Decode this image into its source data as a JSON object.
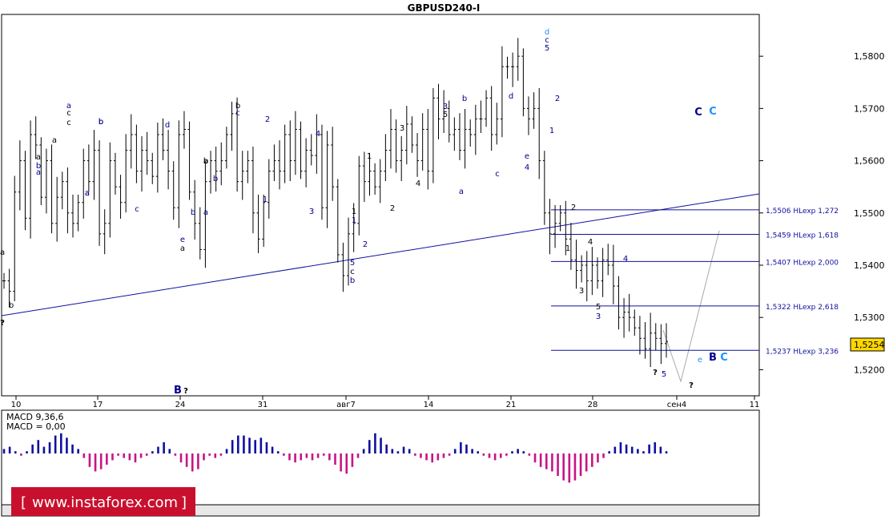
{
  "chart_title": "GBPUSD240-I",
  "chart_data": {
    "type": "line",
    "title": "GBPUSD240-I",
    "ylim": [
      1.515,
      1.588
    ],
    "y_ticks": [
      "1,5800",
      "1,5700",
      "1,5600",
      "1,5500",
      "1,5400",
      "1,5300",
      "1,5200"
    ],
    "y_tick_values": [
      1.58,
      1.57,
      1.56,
      1.55,
      1.54,
      1.53,
      1.52
    ],
    "x_ticks": [
      "10",
      "17",
      "24",
      "31",
      "авг7",
      "14",
      "21",
      "28",
      "сен4",
      "11"
    ],
    "current_price": "1,5254",
    "series": [
      {
        "values": [
          1.537,
          1.535,
          1.554,
          1.56,
          1.549,
          1.565,
          1.563,
          1.553,
          1.56,
          1.548,
          1.553,
          1.556,
          1.55,
          1.548,
          1.552,
          1.56,
          1.556,
          1.562,
          1.546,
          1.548,
          1.56,
          1.555,
          1.552,
          1.562,
          1.565,
          1.558,
          1.562,
          1.56,
          1.557,
          1.565,
          1.562,
          1.558,
          1.551,
          1.565,
          1.566,
          1.554,
          1.548,
          1.543,
          1.556,
          1.56,
          1.558,
          1.56,
          1.565,
          1.569,
          1.556,
          1.558,
          1.56,
          1.55,
          1.545,
          1.552,
          1.558,
          1.56,
          1.558,
          1.565,
          1.56,
          1.566,
          1.558,
          1.562,
          1.561,
          1.565,
          1.551,
          1.563,
          1.555,
          1.542,
          1.538,
          1.546,
          1.548,
          1.559,
          1.556,
          1.558,
          1.555,
          1.558,
          1.562,
          1.566,
          1.56,
          1.562,
          1.567,
          1.563,
          1.56,
          1.566,
          1.558,
          1.572,
          1.568,
          1.57,
          1.565,
          1.566,
          1.562,
          1.566,
          1.565,
          1.568,
          1.568,
          1.572,
          1.565,
          1.568,
          1.578,
          1.578,
          1.578,
          1.58,
          1.57,
          1.568,
          1.57,
          1.56,
          1.55,
          1.546,
          1.548,
          1.55,
          1.545,
          1.541,
          1.539,
          1.54,
          1.537,
          1.54,
          1.537,
          1.541,
          1.54,
          1.536,
          1.53,
          1.531,
          1.53,
          1.528,
          1.526,
          1.524,
          1.527,
          1.526,
          1.525,
          1.5254
        ]
      }
    ]
  },
  "fib_levels": [
    {
      "value": 1.5506,
      "label": "1,5506 HLexp 1,272"
    },
    {
      "value": 1.5459,
      "label": "1,5459 HLexp 1,618"
    },
    {
      "value": 1.5407,
      "label": "1,5407 HLexp 2,000"
    },
    {
      "value": 1.5322,
      "label": "1,5322 HLexp 2,618"
    },
    {
      "value": 1.5237,
      "label": "1,5237 HLexp 3,236"
    }
  ],
  "wave_labels": [
    {
      "t": "a",
      "c": "#000"
    },
    {
      "t": "b",
      "c": "#000"
    },
    {
      "t": "?",
      "c": "#000"
    },
    {
      "t": "a",
      "c": "#00008b"
    },
    {
      "t": "c",
      "c": "#000"
    },
    {
      "t": "a",
      "c": "#000"
    },
    {
      "t": "a",
      "c": "#000"
    },
    {
      "t": "b",
      "c": "#00008b"
    },
    {
      "t": "a",
      "c": "#00008b"
    },
    {
      "t": "a",
      "c": "#00008b"
    },
    {
      "t": "c",
      "c": "#000"
    },
    {
      "t": "b",
      "c": "#00008b"
    },
    {
      "t": "a",
      "c": "#00008b"
    },
    {
      "t": "b",
      "c": "#00008b"
    },
    {
      "t": "c",
      "c": "#00008b"
    },
    {
      "t": "d",
      "c": "#00008b"
    },
    {
      "t": "e",
      "c": "#00008b"
    },
    {
      "t": "a",
      "c": "#000"
    },
    {
      "t": "b",
      "c": "#00008b"
    },
    {
      "t": "b",
      "c": "#000"
    },
    {
      "t": "a",
      "c": "#00008b"
    },
    {
      "t": "b",
      "c": "#000"
    },
    {
      "t": "c",
      "c": "#00008b"
    },
    {
      "t": "a",
      "c": "#000"
    },
    {
      "t": "b",
      "c": "#00008b"
    },
    {
      "t": "2",
      "c": "#00008b"
    },
    {
      "t": "1",
      "c": "#00008b"
    },
    {
      "t": "4",
      "c": "#00008b"
    },
    {
      "t": "3",
      "c": "#00008b"
    },
    {
      "t": "1",
      "c": "#000"
    },
    {
      "t": "1",
      "c": "#000"
    },
    {
      "t": "5",
      "c": "#00008b"
    },
    {
      "t": "c",
      "c": "#000"
    },
    {
      "t": "b",
      "c": "#00008b"
    },
    {
      "t": "2",
      "c": "#00008b"
    },
    {
      "t": "1",
      "c": "#00008b"
    },
    {
      "t": "2",
      "c": "#000"
    },
    {
      "t": "3",
      "c": "#000"
    },
    {
      "t": "4",
      "c": "#000"
    },
    {
      "t": "3",
      "c": "#00008b"
    },
    {
      "t": "5",
      "c": "#000"
    },
    {
      "t": "b",
      "c": "#00008b"
    },
    {
      "t": "a",
      "c": "#00008b"
    },
    {
      "t": "c",
      "c": "#00008b"
    },
    {
      "t": "d",
      "c": "#00008b"
    },
    {
      "t": "e",
      "c": "#00008b"
    },
    {
      "t": "4",
      "c": "#00008b"
    },
    {
      "t": "d",
      "c": "#1e90ff"
    },
    {
      "t": "c",
      "c": "#00008b"
    },
    {
      "t": "5",
      "c": "#00008b"
    },
    {
      "t": "2",
      "c": "#00008b"
    },
    {
      "t": "1",
      "c": "#00008b"
    },
    {
      "t": "2",
      "c": "#000"
    },
    {
      "t": "1",
      "c": "#000"
    },
    {
      "t": "4",
      "c": "#000"
    },
    {
      "t": "3",
      "c": "#000"
    },
    {
      "t": "5",
      "c": "#000"
    },
    {
      "t": "3",
      "c": "#00008b"
    },
    {
      "t": "4",
      "c": "#00008b"
    },
    {
      "t": "?",
      "c": "#000"
    },
    {
      "t": "5",
      "c": "#00008b"
    },
    {
      "t": "?",
      "c": "#000"
    },
    {
      "t": "C",
      "c": "#00008b"
    },
    {
      "t": "C",
      "c": "#1e90ff"
    },
    {
      "t": "e",
      "c": "#1e90ff"
    },
    {
      "t": "B",
      "c": "#00008b"
    },
    {
      "t": "C",
      "c": "#1e90ff"
    },
    {
      "t": "B",
      "c": "#00008b"
    },
    {
      "t": "?",
      "c": "#000"
    }
  ],
  "macd": {
    "label": "MACD 9,36,6",
    "value_label": "MACD = 0,00",
    "values": [
      0.2,
      0.3,
      0.1,
      -0.1,
      0.1,
      0.4,
      0.6,
      0.3,
      0.5,
      0.8,
      0.9,
      0.7,
      0.4,
      0.2,
      -0.2,
      -0.6,
      -0.8,
      -0.7,
      -0.5,
      -0.3,
      -0.1,
      -0.2,
      -0.3,
      -0.4,
      -0.2,
      -0.1,
      0.1,
      0.3,
      0.5,
      0.2,
      -0.1,
      -0.4,
      -0.6,
      -0.8,
      -0.7,
      -0.3,
      -0.1,
      -0.2,
      -0.1,
      0.2,
      0.6,
      0.8,
      0.8,
      0.7,
      0.6,
      0.7,
      0.5,
      0.3,
      0.1,
      -0.1,
      -0.3,
      -0.4,
      -0.3,
      -0.2,
      -0.3,
      -0.2,
      -0.1,
      -0.3,
      -0.5,
      -0.8,
      -0.9,
      -0.6,
      -0.2,
      0.2,
      0.6,
      0.9,
      0.7,
      0.4,
      0.2,
      0.1,
      0.3,
      0.2,
      -0.1,
      -0.2,
      -0.3,
      -0.4,
      -0.3,
      -0.2,
      -0.1,
      0.2,
      0.5,
      0.4,
      0.2,
      0.1,
      -0.1,
      -0.2,
      -0.3,
      -0.2,
      -0.1,
      0.1,
      0.2,
      0.1,
      -0.1,
      -0.4,
      -0.6,
      -0.7,
      -0.8,
      -1.0,
      -1.2,
      -1.3,
      -1.2,
      -1.0,
      -0.8,
      -0.6,
      -0.4,
      -0.2,
      0.1,
      0.3,
      0.5,
      0.4,
      0.3,
      0.2,
      0.1,
      0.4,
      0.5,
      0.3,
      0.1
    ]
  },
  "watermark": "www.instaforex.com"
}
